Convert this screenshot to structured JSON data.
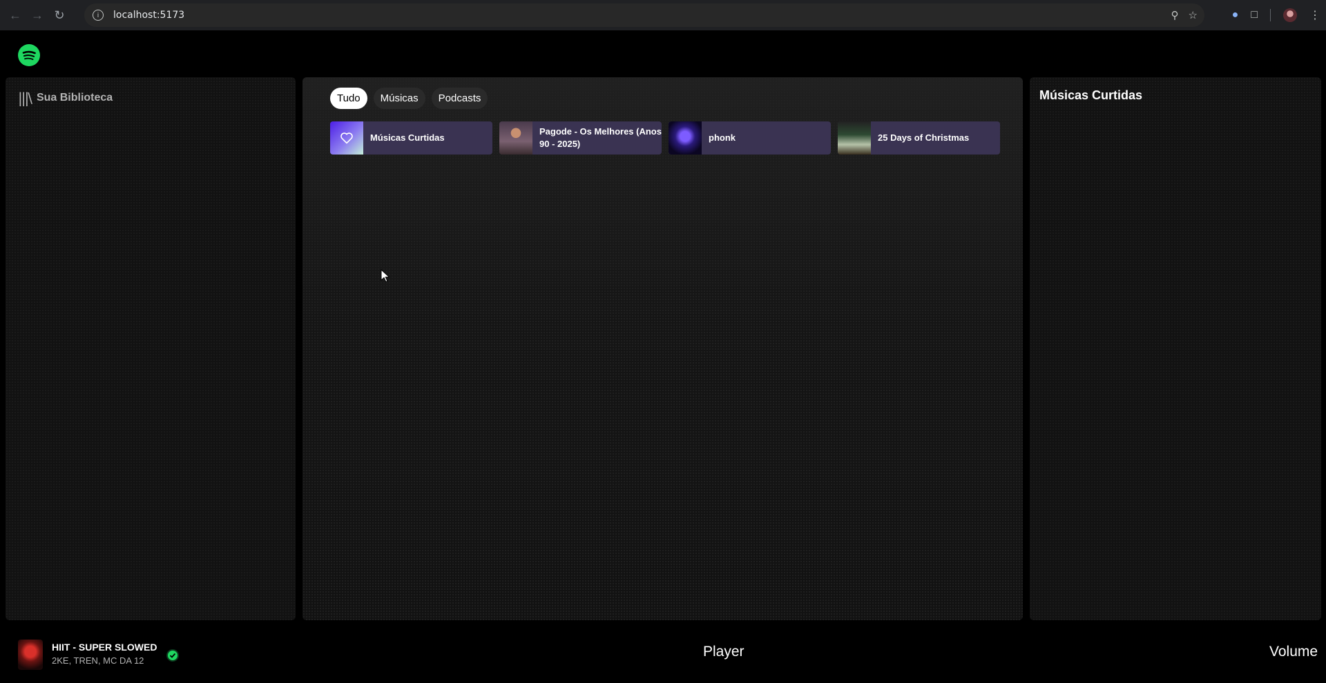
{
  "browser": {
    "url": "localhost:5173",
    "back_icon": "arrow-left-icon",
    "forward_icon": "arrow-right-icon",
    "reload_icon": "reload-icon"
  },
  "app": {
    "brand_color": "#1ed760",
    "library": {
      "title": "Sua Biblioteca",
      "icon": "library-icon"
    },
    "filters": [
      {
        "label": "Tudo",
        "active": true
      },
      {
        "label": "Músicas",
        "active": false
      },
      {
        "label": "Podcasts",
        "active": false
      }
    ],
    "shortcuts": [
      {
        "label": "Músicas Curtidas",
        "icon": "heart-icon"
      },
      {
        "label": "Pagode - Os Melhores (Anos 90 - 2025)"
      },
      {
        "label": "phonk"
      },
      {
        "label": "25 Days of Christmas"
      }
    ],
    "right_panel": {
      "title": "Músicas Curtidas"
    },
    "now_playing": {
      "title": "HIIT - SUPER SLOWED",
      "artists": "2KE, TREN, MC DA 12",
      "saved_icon": "check-circle-icon"
    },
    "player_label": "Player",
    "volume_label": "Volume"
  }
}
